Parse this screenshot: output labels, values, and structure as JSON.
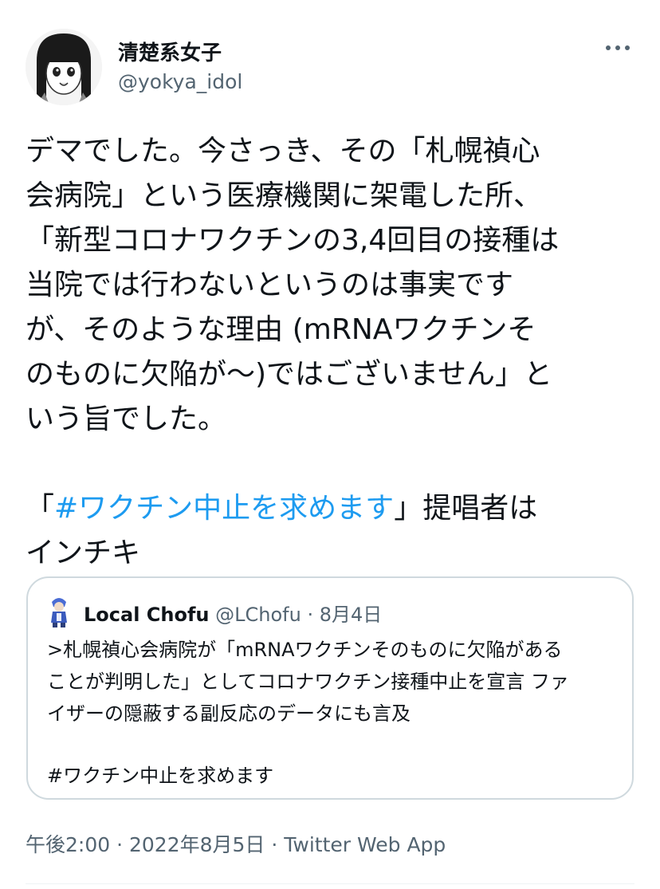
{
  "author": {
    "display_name": "清楚系女子",
    "handle": "@yokya_idol"
  },
  "tweet": {
    "lines": [
      "デマでした。今さっき、その「札幌禎心",
      "会病院」という医療機関に架電した所、",
      "「新型コロナワクチンの3,4回目の接種は",
      "当院では行わないというのは事実です",
      "が、そのような理由 (mRNAワクチンそ",
      "のものに欠陥が〜)ではございません」と",
      "いう旨でした。"
    ],
    "hashtag_prefix": "「",
    "hashtag": "#ワクチン中止を求めます",
    "hashtag_suffix": "」提唱者は",
    "last_line": "インチキ"
  },
  "quote": {
    "display_name": "Local Chofu",
    "handle": "@LChofu",
    "separator": " · ",
    "date": "8月4日",
    "lines": [
      ">札幌禎心会病院が「mRNAワクチンそのものに欠陥がある",
      "ことが判明した」としてコロナワクチン接種中止を宣言 ファ",
      "イザーの隠蔽する副反応のデータにも言及"
    ],
    "hashtag": "#ワクチン中止を求めます"
  },
  "meta": {
    "time": "午後2:00",
    "separator": " · ",
    "date": "2022年8月5日",
    "via": "Twitter Web App"
  },
  "icons": {
    "more": "more-horizontal-icon",
    "avatar": "user-avatar",
    "quote_avatar": "quoted-user-avatar"
  },
  "colors": {
    "link": "#1d9bf0",
    "secondary_text": "#536471",
    "border": "#cfd9de"
  }
}
